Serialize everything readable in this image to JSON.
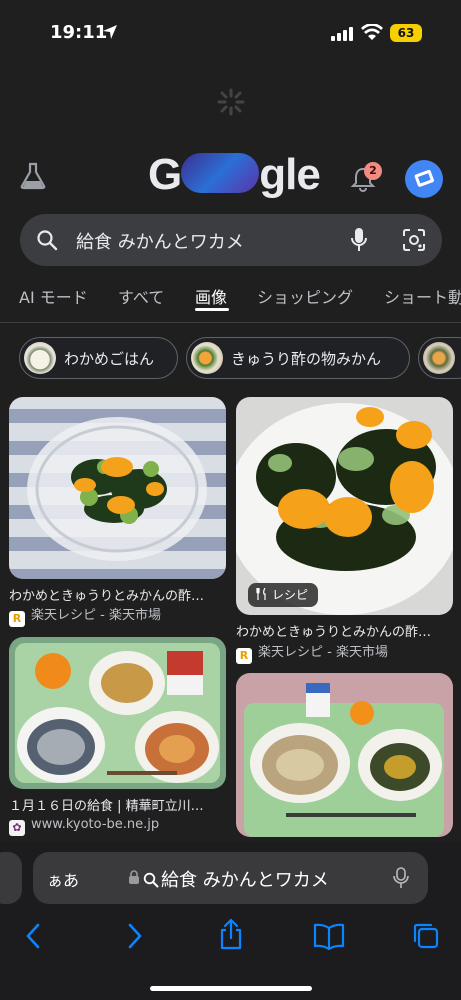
{
  "status_bar": {
    "time": "19:11",
    "battery": "63"
  },
  "header": {
    "logo_text": "Google",
    "notification_count": "2",
    "icons": [
      "flask-icon",
      "bell-icon",
      "avatar"
    ]
  },
  "search": {
    "query": "給食 みかんとワカメ"
  },
  "tabs": [
    {
      "label": "AI モード"
    },
    {
      "label": "すべて"
    },
    {
      "label": "画像"
    },
    {
      "label": "ショッピング"
    },
    {
      "label": "ショート動"
    }
  ],
  "active_tab": "画像",
  "chips": [
    {
      "label": "わかめごはん"
    },
    {
      "label": "きゅうり酢の物みかん"
    }
  ],
  "results": [
    {
      "title": "わかめときゅうりとみかんの酢…",
      "source": "楽天レシピ - 楽天市場"
    },
    {
      "title": "わかめときゅうりとみかんの酢…",
      "source": "楽天レシピ - 楽天市場",
      "badge": "レシピ"
    },
    {
      "title": "１月１６日の給食 | 精華町立川…",
      "source": "www.kyoto-be.ne.jp"
    },
    {
      "title": "",
      "source": ""
    }
  ],
  "safari": {
    "aa_label": "ぁあ",
    "address_query": "給食 みかんとワカメ"
  },
  "colors": {
    "background": "#1f1f1f",
    "search_bg": "#3c3d40",
    "accent_blue": "#4285f4",
    "badge_red": "#f28b82",
    "ios_blue": "#0a84ff"
  }
}
